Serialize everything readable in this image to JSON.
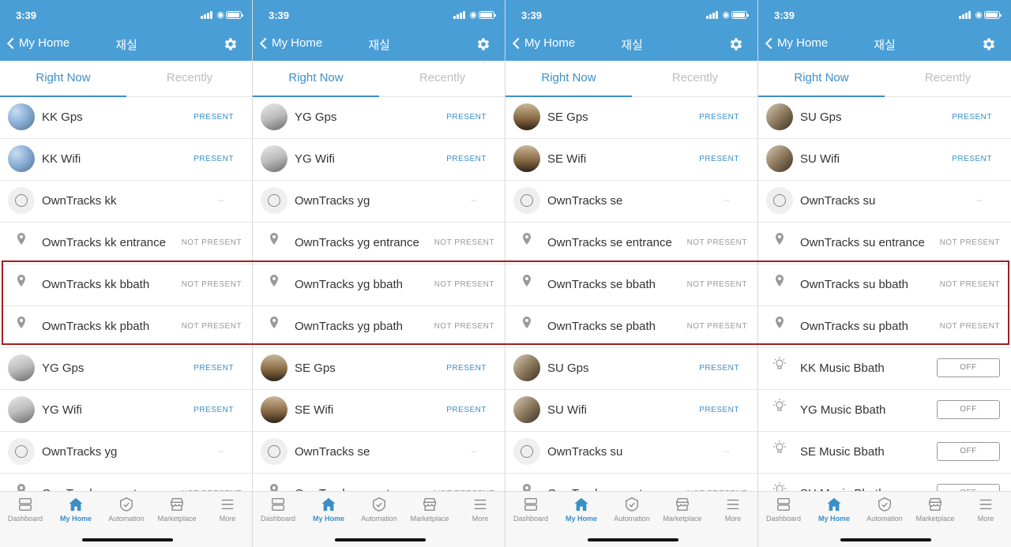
{
  "status_time": "3:39",
  "header": {
    "back_label": "My Home",
    "title": "재실"
  },
  "tabs": {
    "active": "Right Now",
    "inactive": "Recently"
  },
  "tabbar": [
    "Dashboard",
    "My Home",
    "Automation",
    "Marketplace",
    "More"
  ],
  "toggle_off": "OFF",
  "phones": [
    {
      "rows": [
        {
          "name": "KK Gps",
          "state": "PRESENT",
          "kind": "present",
          "icon": "avatar-sky"
        },
        {
          "name": "KK Wifi",
          "state": "PRESENT",
          "kind": "present",
          "icon": "avatar-sky"
        },
        {
          "name": "OwnTracks kk",
          "state": "--",
          "kind": "unknown",
          "icon": "circle"
        },
        {
          "name": "OwnTracks kk entrance",
          "state": "NOT PRESENT",
          "kind": "absent",
          "icon": "pin"
        },
        {
          "name": "OwnTracks kk bbath",
          "state": "NOT PRESENT",
          "kind": "absent",
          "icon": "pin"
        },
        {
          "name": "OwnTracks kk pbath",
          "state": "NOT PRESENT",
          "kind": "absent",
          "icon": "pin"
        },
        {
          "name": "YG Gps",
          "state": "PRESENT",
          "kind": "present",
          "icon": "avatar-plane"
        },
        {
          "name": "YG Wifi",
          "state": "PRESENT",
          "kind": "present",
          "icon": "avatar-plane"
        },
        {
          "name": "OwnTracks yg",
          "state": "--",
          "kind": "unknown",
          "icon": "circle"
        },
        {
          "name": "OwnTracks yg entrance",
          "state": "NOT PRESENT",
          "kind": "absent",
          "icon": "pin"
        }
      ]
    },
    {
      "rows": [
        {
          "name": "YG Gps",
          "state": "PRESENT",
          "kind": "present",
          "icon": "avatar-plane"
        },
        {
          "name": "YG Wifi",
          "state": "PRESENT",
          "kind": "present",
          "icon": "avatar-plane"
        },
        {
          "name": "OwnTracks yg",
          "state": "--",
          "kind": "unknown",
          "icon": "circle"
        },
        {
          "name": "OwnTracks yg entrance",
          "state": "NOT PRESENT",
          "kind": "absent",
          "icon": "pin"
        },
        {
          "name": "OwnTracks yg bbath",
          "state": "NOT PRESENT",
          "kind": "absent",
          "icon": "pin"
        },
        {
          "name": "OwnTracks yg pbath",
          "state": "NOT PRESENT",
          "kind": "absent",
          "icon": "pin"
        },
        {
          "name": "SE Gps",
          "state": "PRESENT",
          "kind": "present",
          "icon": "avatar-city"
        },
        {
          "name": "SE Wifi",
          "state": "PRESENT",
          "kind": "present",
          "icon": "avatar-city"
        },
        {
          "name": "OwnTracks se",
          "state": "--",
          "kind": "unknown",
          "icon": "circle"
        },
        {
          "name": "OwnTracks se entrance",
          "state": "NOT PRESENT",
          "kind": "absent",
          "icon": "pin"
        }
      ]
    },
    {
      "rows": [
        {
          "name": "SE Gps",
          "state": "PRESENT",
          "kind": "present",
          "icon": "avatar-city"
        },
        {
          "name": "SE Wifi",
          "state": "PRESENT",
          "kind": "present",
          "icon": "avatar-city"
        },
        {
          "name": "OwnTracks se",
          "state": "--",
          "kind": "unknown",
          "icon": "circle"
        },
        {
          "name": "OwnTracks se entrance",
          "state": "NOT PRESENT",
          "kind": "absent",
          "icon": "pin"
        },
        {
          "name": "OwnTracks se bbath",
          "state": "NOT PRESENT",
          "kind": "absent",
          "icon": "pin"
        },
        {
          "name": "OwnTracks se pbath",
          "state": "NOT PRESENT",
          "kind": "absent",
          "icon": "pin"
        },
        {
          "name": "SU Gps",
          "state": "PRESENT",
          "kind": "present",
          "icon": "avatar-car"
        },
        {
          "name": "SU Wifi",
          "state": "PRESENT",
          "kind": "present",
          "icon": "avatar-car"
        },
        {
          "name": "OwnTracks su",
          "state": "--",
          "kind": "unknown",
          "icon": "circle"
        },
        {
          "name": "OwnTracks su entrance",
          "state": "NOT PRESENT",
          "kind": "absent",
          "icon": "pin"
        }
      ]
    },
    {
      "rows": [
        {
          "name": "SU Gps",
          "state": "PRESENT",
          "kind": "present",
          "icon": "avatar-car"
        },
        {
          "name": "SU Wifi",
          "state": "PRESENT",
          "kind": "present",
          "icon": "avatar-car"
        },
        {
          "name": "OwnTracks su",
          "state": "--",
          "kind": "unknown",
          "icon": "circle"
        },
        {
          "name": "OwnTracks su entrance",
          "state": "NOT PRESENT",
          "kind": "absent",
          "icon": "pin"
        },
        {
          "name": "OwnTracks su bbath",
          "state": "NOT PRESENT",
          "kind": "absent",
          "icon": "pin"
        },
        {
          "name": "OwnTracks su pbath",
          "state": "NOT PRESENT",
          "kind": "absent",
          "icon": "pin"
        },
        {
          "name": "KK Music Bbath",
          "state": "OFF",
          "kind": "toggle",
          "icon": "bulb"
        },
        {
          "name": "YG Music Bbath",
          "state": "OFF",
          "kind": "toggle",
          "icon": "bulb"
        },
        {
          "name": "SE Music Bbath",
          "state": "OFF",
          "kind": "toggle",
          "icon": "bulb"
        },
        {
          "name": "SU Music Bbath",
          "state": "OFF",
          "kind": "toggle",
          "icon": "bulb"
        }
      ]
    }
  ],
  "colors": {
    "header": "#4a9ed6",
    "accent": "#3b8fc9",
    "highlight": "#a31f22"
  }
}
